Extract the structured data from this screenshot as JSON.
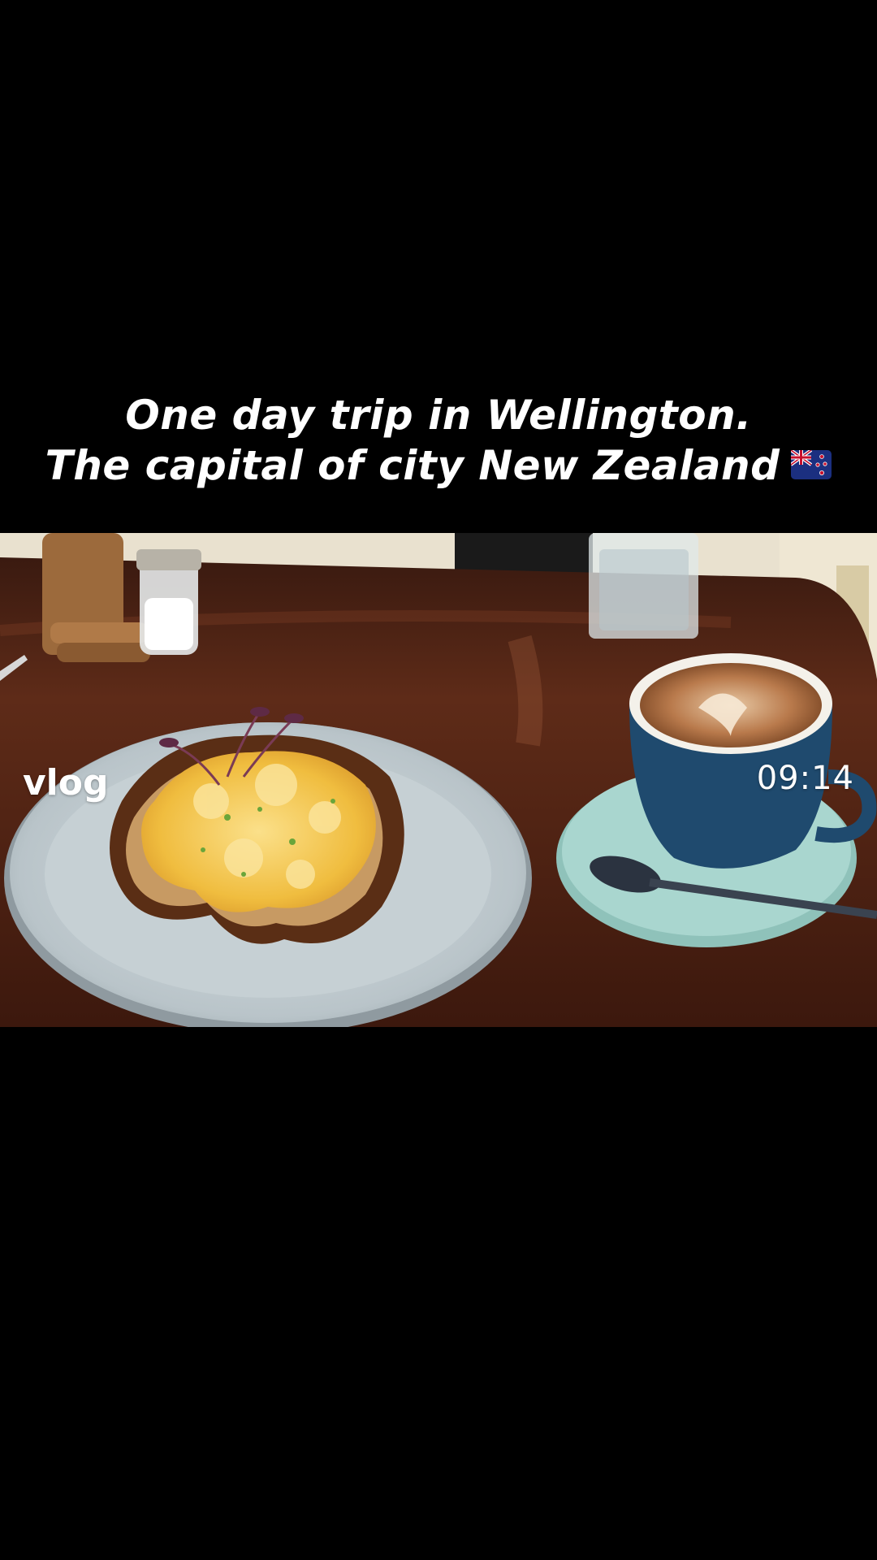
{
  "caption": {
    "line1": "One day trip in Wellington.",
    "line2": "The capital of city New Zealand",
    "flag_icon": "new-zealand-flag-icon"
  },
  "overlay": {
    "tag": "vlog",
    "time": "09:14"
  },
  "colors": {
    "background": "#000000",
    "table": "#5a2a1a",
    "plate": "#c9d2d6",
    "saucer": "#a9d6cf",
    "cup": "#1f4a6e",
    "egg": "#f1c24a"
  }
}
